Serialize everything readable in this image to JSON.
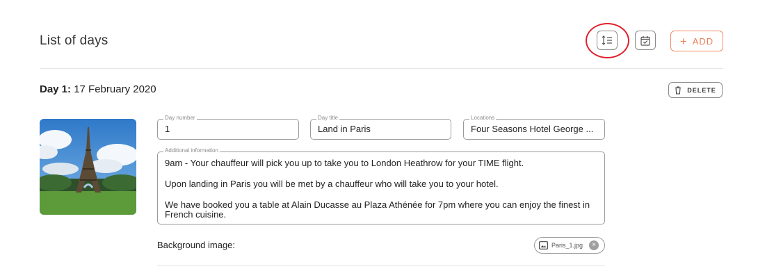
{
  "header": {
    "title": "List of days",
    "add_label": "ADD",
    "add_icon": "plus-icon",
    "reorder_icon": "list-order-icon",
    "calendar_icon": "calendar-check-icon",
    "highlight_color": "#e0202a",
    "accent_color": "#ef7e55"
  },
  "day": {
    "label": "Day 1:",
    "date": "17 February 2020",
    "delete_label": "DELETE",
    "delete_icon": "trash-icon",
    "image_subject": "eiffel-tower-photo",
    "fields": {
      "day_number": {
        "legend": "Day number",
        "value": "1"
      },
      "day_title": {
        "legend": "Day title",
        "value": "Land in Paris"
      },
      "locations": {
        "legend": "Locations",
        "value": "Four Seasons Hotel George ..."
      },
      "additional_info": {
        "legend": "Additional information",
        "paragraphs": [
          "9am - Your chauffeur will pick you up to take you to London Heathrow for your TIME flight.",
          "Upon landing in Paris you will be met by a chauffeur who will take you to your hotel.",
          "We have booked you a table at Alain Ducasse au Plaza Athénée for 7pm where you can enjoy the finest in French cuisine."
        ]
      }
    },
    "background_image": {
      "label": "Background image:",
      "file_name": "Paris_1.jpg",
      "file_icon": "image-icon",
      "remove_icon": "close-circle-icon"
    }
  }
}
